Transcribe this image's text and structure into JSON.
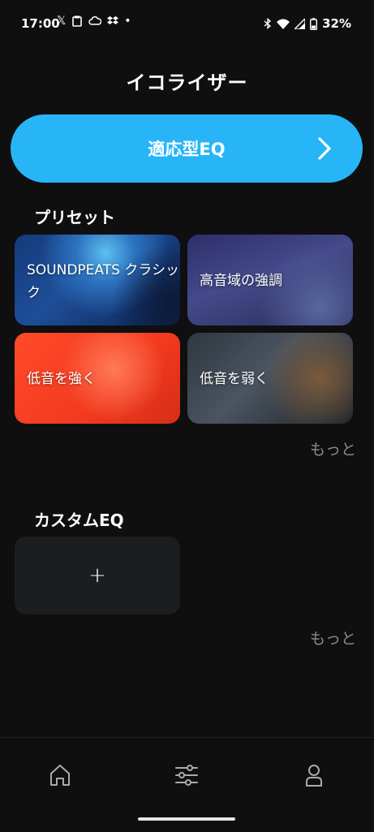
{
  "status_bar": {
    "time": "17:00",
    "left_icons": [
      "x-logo-icon",
      "clipboard-icon",
      "cloud-icon",
      "dropbox-icon",
      "dot-icon"
    ],
    "right_icons": [
      "bluetooth-icon",
      "wifi-icon",
      "signal-icon",
      "battery-icon"
    ],
    "battery": "32%"
  },
  "header": {
    "title": "イコライザー"
  },
  "adaptive_eq": {
    "label": "適応型EQ"
  },
  "presets": {
    "title": "プリセット",
    "cards": [
      {
        "label": "SOUNDPEATS クラシック"
      },
      {
        "label": "高音域の強調"
      },
      {
        "label": "低音を強く"
      },
      {
        "label": "低音を弱く"
      }
    ],
    "more": "もっと"
  },
  "custom_eq": {
    "title": "カスタムEQ",
    "add_label": "+",
    "more": "もっと"
  },
  "bottom_nav": {
    "items": [
      "home-icon",
      "equalizer-icon",
      "profile-icon"
    ]
  }
}
